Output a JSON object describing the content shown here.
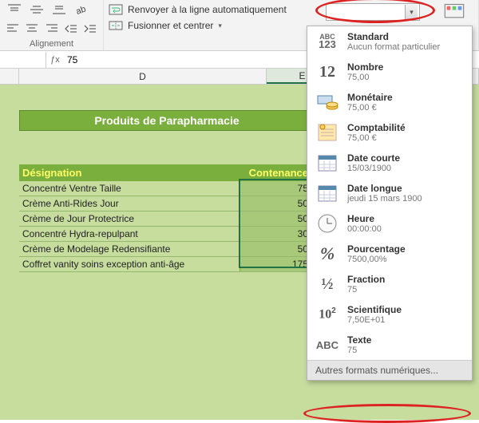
{
  "ribbon": {
    "wrap_text_label": "Renvoyer à la ligne automatiquement",
    "merge_center_label": "Fusionner et centrer",
    "alignment_group": "Alignement"
  },
  "name_box": "",
  "formula_value": "75",
  "columns": {
    "D": "D",
    "E": "E"
  },
  "banner": "Produits de Parapharmacie",
  "table": {
    "headers": {
      "designation": "Désignation",
      "contenance": "Contenance"
    },
    "rows": [
      {
        "des": "Concentré Ventre Taille",
        "con": "75"
      },
      {
        "des": "Crème Anti-Rides Jour",
        "con": "50"
      },
      {
        "des": "Crème de Jour Protectrice",
        "con": "50"
      },
      {
        "des": "Concentré Hydra-repulpant",
        "con": "30"
      },
      {
        "des": "Crème de Modelage Redensifiante",
        "con": "50"
      },
      {
        "des": "Coffret vanity soins exception anti-âge",
        "con": "175"
      }
    ]
  },
  "formats": [
    {
      "icon": "ABC123",
      "title": "Standard",
      "sample": "Aucun format particulier"
    },
    {
      "icon": "12",
      "title": "Nombre",
      "sample": "75,00"
    },
    {
      "icon": "coins",
      "title": "Monétaire",
      "sample": "75,00 €"
    },
    {
      "icon": "ledger",
      "title": "Comptabilité",
      "sample": "75,00 €"
    },
    {
      "icon": "cal",
      "title": "Date courte",
      "sample": "15/03/1900"
    },
    {
      "icon": "cal",
      "title": "Date longue",
      "sample": "jeudi 15 mars 1900"
    },
    {
      "icon": "clock",
      "title": "Heure",
      "sample": "00:00:00"
    },
    {
      "icon": "%",
      "title": "Pourcentage",
      "sample": "7500,00%"
    },
    {
      "icon": "1/2",
      "title": "Fraction",
      "sample": "75"
    },
    {
      "icon": "10^2",
      "title": "Scientifique",
      "sample": "7,50E+01"
    },
    {
      "icon": "ABC",
      "title": "Texte",
      "sample": "75"
    }
  ],
  "formats_footer": "Autres formats numériques..."
}
